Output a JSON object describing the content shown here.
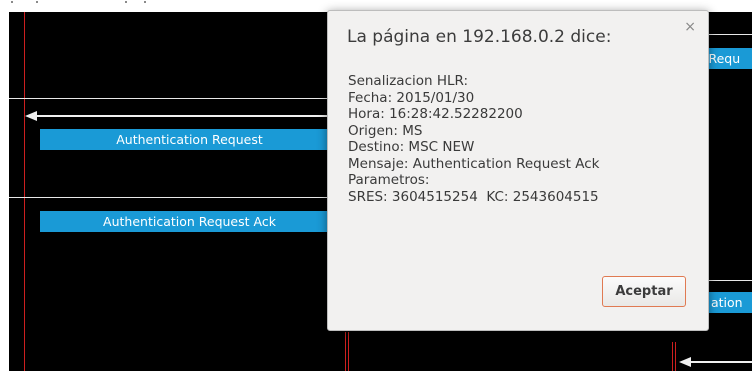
{
  "diagram": {
    "messages": {
      "auth_request": "Authentication Request",
      "auth_request_ack": "Authentication Request Ack",
      "right_top_partial": "s Requ",
      "right_bottom_partial": "ation"
    }
  },
  "dialog": {
    "title": "La página en 192.168.0.2 dice:",
    "close_glyph": "×",
    "lines": [
      "Senalizacion HLR:",
      "Fecha: 2015/01/30",
      "Hora: 16:28:42.52282200",
      "Origen: MS",
      "Destino: MSC NEW",
      "Mensaje: Authentication Request Ack",
      "Parametros:",
      "SRES: 3604515254  KC: 2543604515"
    ],
    "ok_label": "Aceptar"
  },
  "colors": {
    "canvas": "#000000",
    "message_bar": "#1a9ad6",
    "lifeline": "#cc1f1f",
    "button_border": "#e07a52"
  }
}
